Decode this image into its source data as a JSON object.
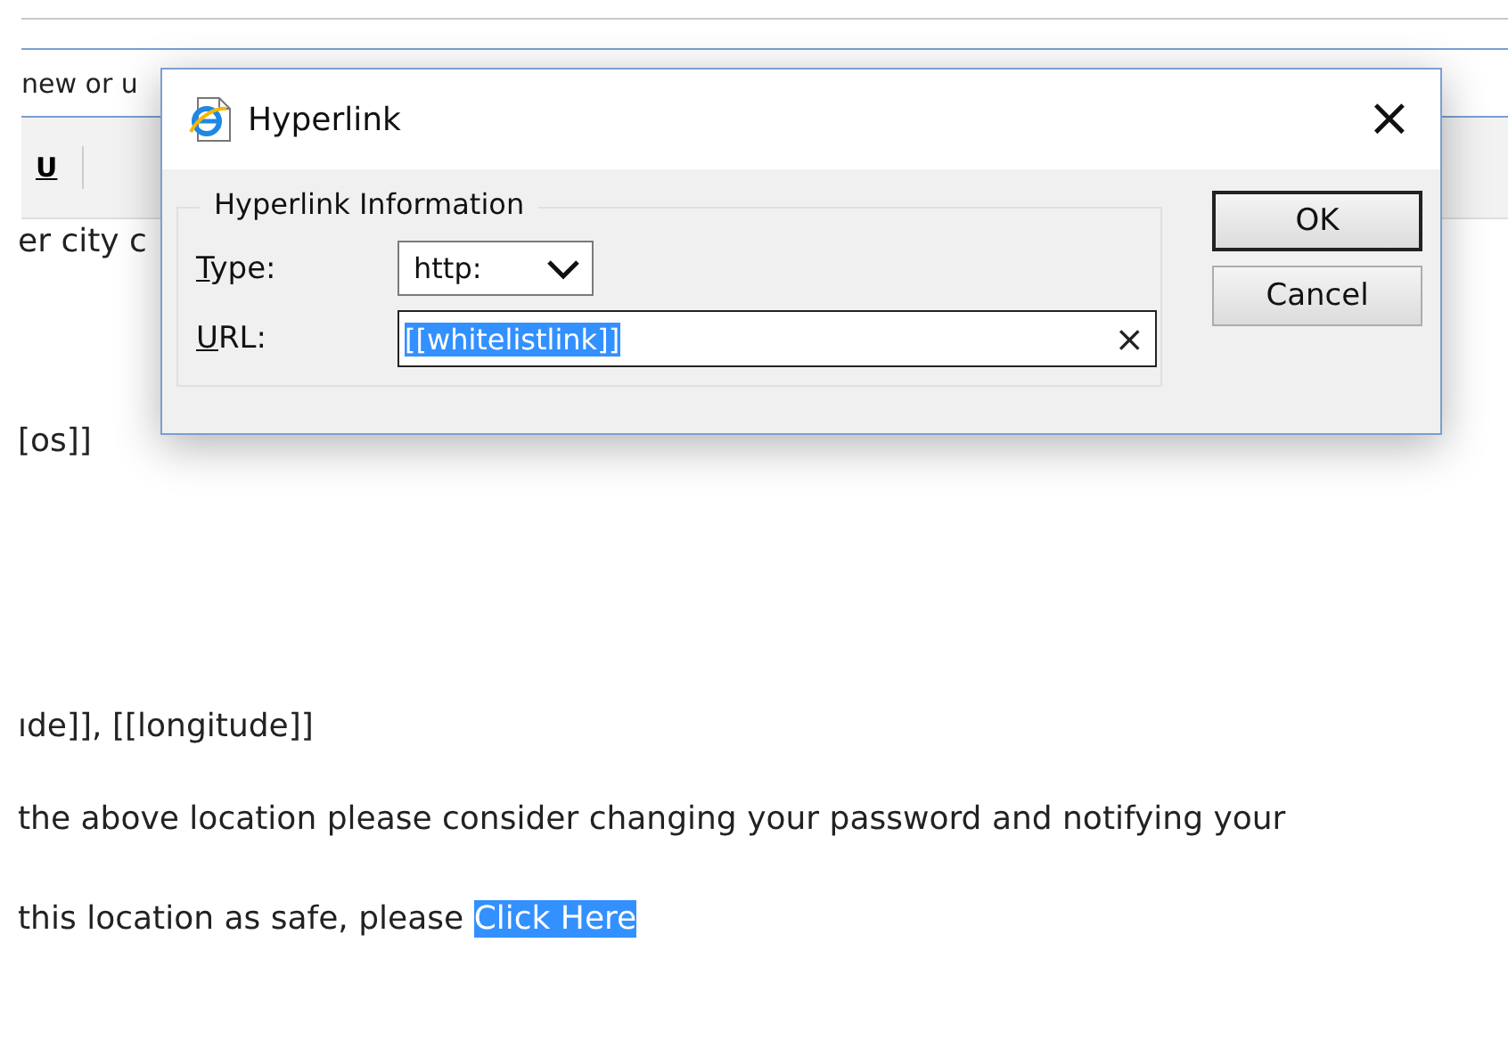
{
  "subject": {
    "value": "new or u"
  },
  "toolbar": {
    "underline_button": "U"
  },
  "editor": {
    "lines": [
      {
        "kind": "text",
        "text": "er city c"
      },
      {
        "kind": "text",
        "text": "[os]]"
      },
      {
        "kind": "text",
        "text": "ıde]], [[longitude]]"
      },
      {
        "kind": "text",
        "text": " the above location please consider changing your password and notifying your"
      },
      {
        "kind": "link",
        "text": " this location as safe, please ",
        "link": "Click Here",
        "selected": true
      }
    ]
  },
  "dialog": {
    "title": "Hyperlink",
    "group": "Hyperlink Information",
    "type": {
      "label": "Type:",
      "value": "http:"
    },
    "url": {
      "label": "URL:",
      "value": "[[whitelistlink]]",
      "selected": true,
      "clear": "×"
    },
    "close": "×",
    "buttons": [
      {
        "label": "OK",
        "default": true
      },
      {
        "label": "Cancel",
        "default": false
      }
    ]
  }
}
